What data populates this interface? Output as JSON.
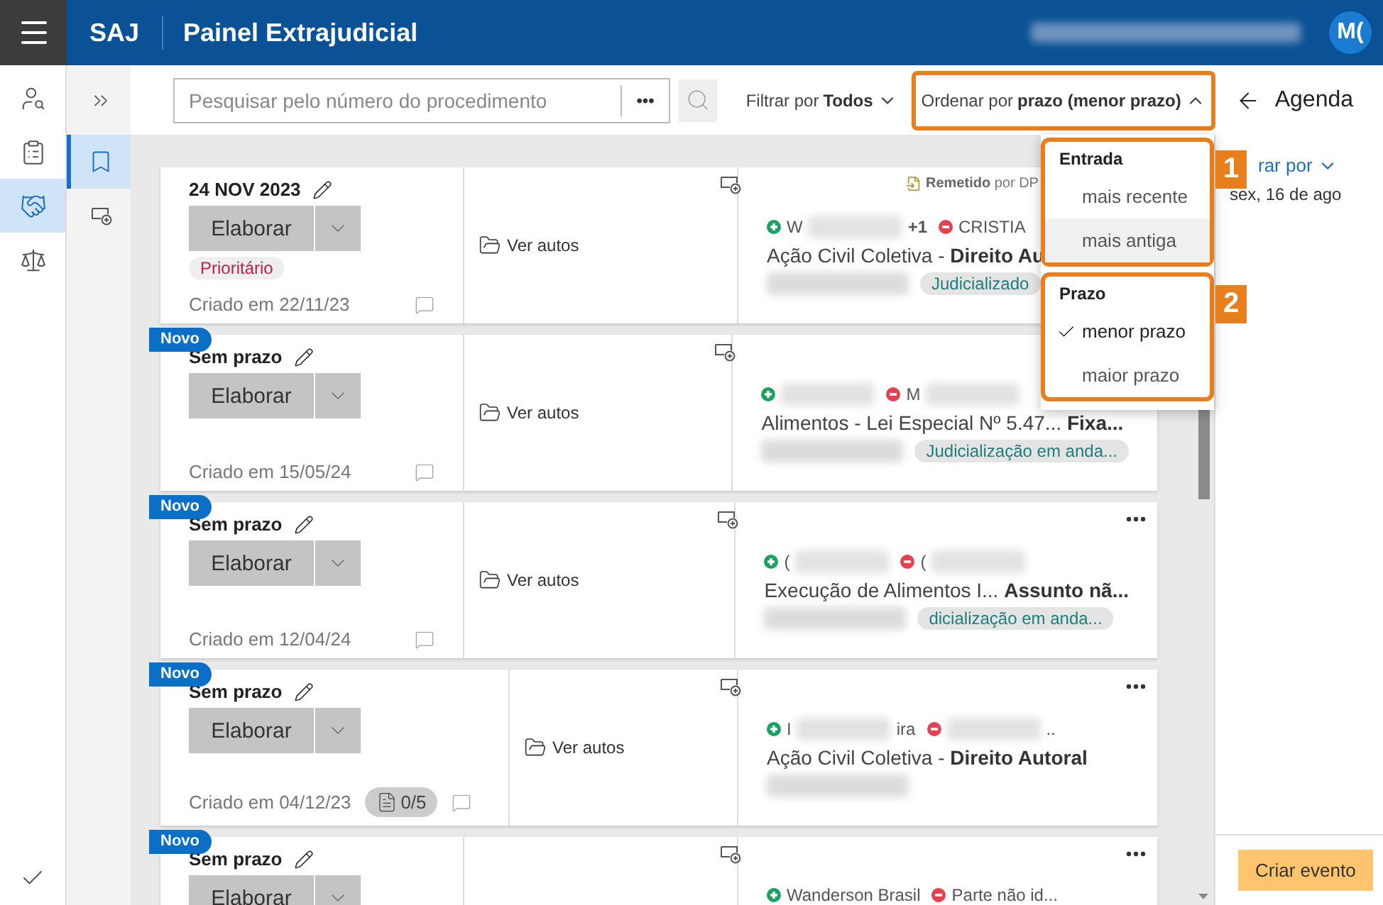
{
  "header": {
    "app": "SAJ",
    "title": "Painel Extrajudicial",
    "avatar": "M("
  },
  "rail": [
    {
      "selected": false
    },
    {
      "selected": false
    },
    {
      "selected": true
    },
    {
      "selected": false
    }
  ],
  "subnav": [
    {
      "selected": true
    },
    {
      "selected": false
    }
  ],
  "toolbar": {
    "search": {
      "placeholder": "Pesquisar pelo número do procedimento"
    },
    "more": "•••",
    "filter": {
      "label": "Filtrar por",
      "value": "Todos"
    },
    "sort": {
      "label": "Ordenar por",
      "value": "prazo (menor prazo)",
      "open": true
    }
  },
  "sort_menu": [
    {
      "label": "Entrada",
      "badge": "1",
      "items": [
        {
          "label": "mais recente",
          "selected": false,
          "hovered": false
        },
        {
          "label": "mais antiga",
          "selected": false,
          "hovered": true
        }
      ]
    },
    {
      "label": "Prazo",
      "badge": "2",
      "items": [
        {
          "label": "menor prazo",
          "selected": true,
          "hovered": false
        },
        {
          "label": "maior prazo",
          "selected": false,
          "hovered": false
        }
      ]
    }
  ],
  "cards": [
    {
      "new": false,
      "deadline": "24 NOV 2023",
      "action": "Elaborar",
      "priority": "Prioritário",
      "created": "Criado em 22/11/23",
      "remetido": {
        "label": "Remetido",
        "by": "por DP"
      },
      "more": false,
      "parties": [
        {
          "kind": "plaintiff",
          "prefix": "W",
          "blurred": true,
          "suffix": "+1"
        },
        {
          "kind": "defendant",
          "prefix": "CRISTIA",
          "blurred": false
        }
      ],
      "subject": "Ação Civil Coletiva - **Direito Au**",
      "status": "Judicializado",
      "link": "Ver autos"
    },
    {
      "new": true,
      "badge": "Novo",
      "deadline": "Sem prazo",
      "action": "Elaborar",
      "created": "Criado em 15/05/24",
      "more": false,
      "parties": [
        {
          "kind": "plaintiff",
          "blurred": true
        },
        {
          "kind": "defendant",
          "prefix": "M",
          "blurred": true
        }
      ],
      "subject": "Alimentos - Lei Especial Nº 5.47... **Fixa...**",
      "status": "Judicialização em anda...",
      "link": "Ver autos"
    },
    {
      "new": true,
      "badge": "Novo",
      "deadline": "Sem prazo",
      "action": "Elaborar",
      "created": "Criado em 12/04/24",
      "more": true,
      "parties": [
        {
          "kind": "plaintiff",
          "prefix": "(",
          "blurred": true
        },
        {
          "kind": "defendant",
          "prefix": "(",
          "blurred": true
        }
      ],
      "subject": "Execução de Alimentos I...  **Assunto nã...**",
      "status": "dicialização em anda...",
      "link": "Ver autos"
    },
    {
      "new": true,
      "badge": "Novo",
      "deadline": "Sem prazo",
      "action": "Elaborar",
      "created": "Criado em 04/12/23",
      "docs": "0/5",
      "more": true,
      "parties": [
        {
          "kind": "plaintiff",
          "prefix": "I",
          "blurred": true,
          "suffix": "ira"
        },
        {
          "kind": "defendant",
          "blurred": true,
          "suffix": ".."
        }
      ],
      "subject": "Ação Civil Coletiva - **Direito Autoral**",
      "link": "Ver autos"
    },
    {
      "new": true,
      "badge": "Novo",
      "deadline": "Sem prazo",
      "action": "Elaborar",
      "more": true,
      "parties": [
        {
          "kind": "plaintiff",
          "prefix": "Wanderson Brasil",
          "blurred": false
        },
        {
          "kind": "defendant",
          "prefix": "Parte não id...",
          "blurred": false
        }
      ]
    }
  ],
  "agenda": {
    "title": "Agenda",
    "filter": "rar por",
    "date": "sex, 16 de ago",
    "create": "Criar evento"
  }
}
